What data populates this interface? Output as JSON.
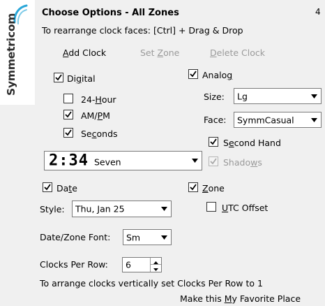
{
  "logo": {
    "text": "Symmetricom"
  },
  "header": {
    "title": "Choose Options - All Zones",
    "corner_char": "4",
    "hint": "To rearrange clock faces: [Ctrl] + Drag & Drop"
  },
  "toolbar": {
    "add_clock": "Add Clock",
    "set_zone": "Set Zone",
    "delete_clock": "Delete Clock"
  },
  "digital": {
    "label": "Digital",
    "checked": true,
    "hour24": {
      "label": "24-Hour",
      "checked": false
    },
    "ampm": {
      "label": "AM/PM",
      "checked": true
    },
    "seconds": {
      "label": "Seconds",
      "checked": true
    },
    "font_select": {
      "preview": "2:34",
      "value": "Seven"
    }
  },
  "analog": {
    "label": "Analog",
    "checked": true,
    "size_label": "Size:",
    "size_value": "Lg",
    "face_label": "Face:",
    "face_value": "SymmCasual",
    "second_hand": {
      "label": "Second Hand",
      "checked": true
    },
    "shadows": {
      "label": "Shadows",
      "checked": true,
      "disabled": true
    }
  },
  "date": {
    "label": "Date",
    "checked": true,
    "style_label": "Style:",
    "style_value": "Thu, Jan 25"
  },
  "zone": {
    "label": "Zone",
    "checked": true,
    "utc_offset": {
      "label": "UTC Offset",
      "checked": false
    }
  },
  "font": {
    "label": "Date/Zone Font:",
    "value": "Sm"
  },
  "clocks_per_row": {
    "label": "Clocks Per Row:",
    "value": "6"
  },
  "info": "To arrange clocks vertically set Clocks Per Row to 1",
  "favorite": "Make this My Favorite Place"
}
